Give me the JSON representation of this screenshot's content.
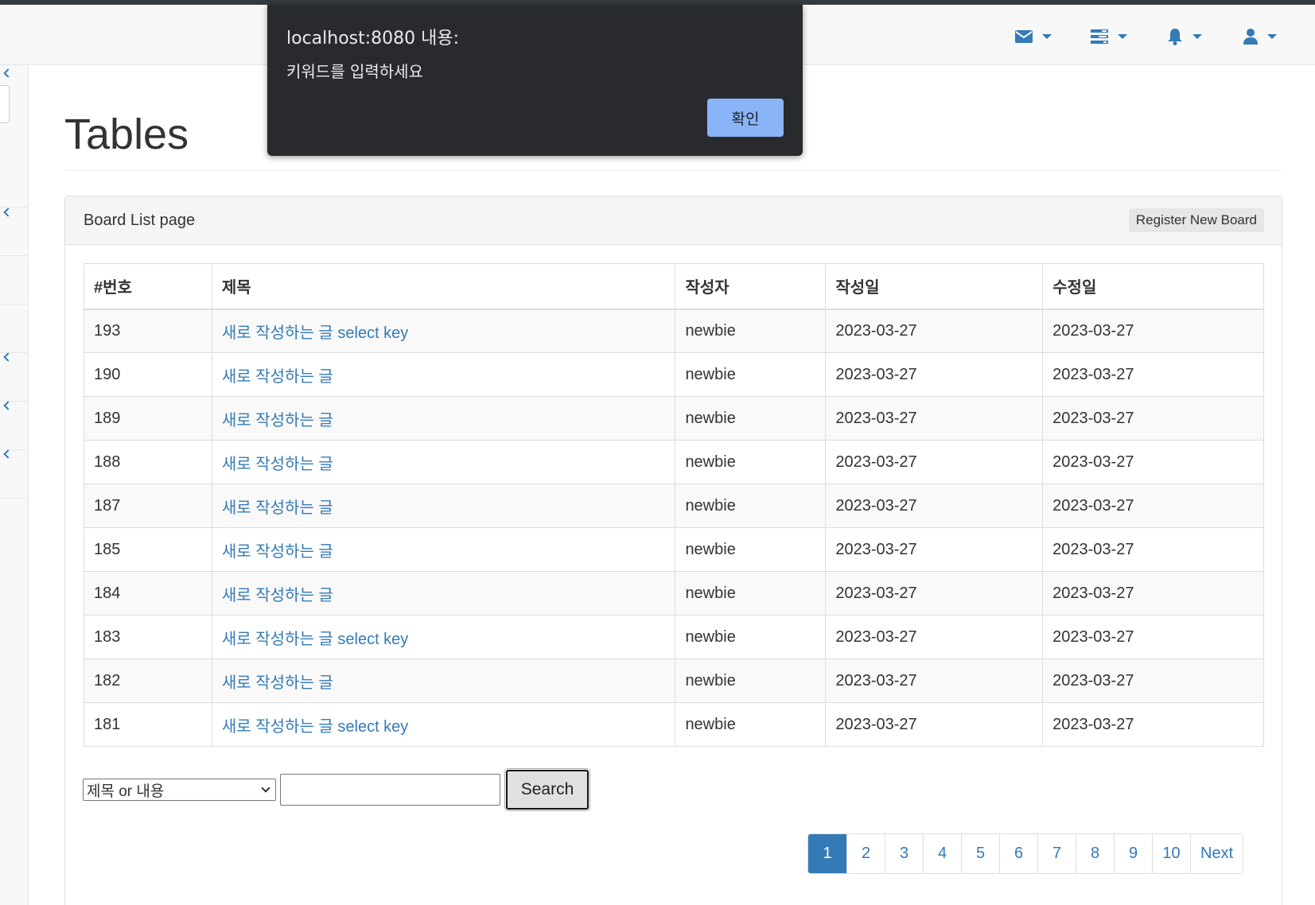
{
  "navbar": {
    "icons": [
      "envelope-icon",
      "tasks-icon",
      "bell-icon",
      "user-icon"
    ]
  },
  "page": {
    "title": "Tables"
  },
  "panel": {
    "heading": "Board List page",
    "register_label": "Register New Board"
  },
  "table": {
    "headers": [
      "#번호",
      "제목",
      "작성자",
      "작성일",
      "수정일"
    ],
    "rows": [
      {
        "bno": "193",
        "title": "새로 작성하는 글 select key",
        "writer": "newbie",
        "regdate": "2023-03-27",
        "updatedate": "2023-03-27"
      },
      {
        "bno": "190",
        "title": "새로 작성하는 글",
        "writer": "newbie",
        "regdate": "2023-03-27",
        "updatedate": "2023-03-27"
      },
      {
        "bno": "189",
        "title": "새로 작성하는 글",
        "writer": "newbie",
        "regdate": "2023-03-27",
        "updatedate": "2023-03-27"
      },
      {
        "bno": "188",
        "title": "새로 작성하는 글",
        "writer": "newbie",
        "regdate": "2023-03-27",
        "updatedate": "2023-03-27"
      },
      {
        "bno": "187",
        "title": "새로 작성하는 글",
        "writer": "newbie",
        "regdate": "2023-03-27",
        "updatedate": "2023-03-27"
      },
      {
        "bno": "185",
        "title": "새로 작성하는 글",
        "writer": "newbie",
        "regdate": "2023-03-27",
        "updatedate": "2023-03-27"
      },
      {
        "bno": "184",
        "title": "새로 작성하는 글",
        "writer": "newbie",
        "regdate": "2023-03-27",
        "updatedate": "2023-03-27"
      },
      {
        "bno": "183",
        "title": "새로 작성하는 글 select key",
        "writer": "newbie",
        "regdate": "2023-03-27",
        "updatedate": "2023-03-27"
      },
      {
        "bno": "182",
        "title": "새로 작성하는 글",
        "writer": "newbie",
        "regdate": "2023-03-27",
        "updatedate": "2023-03-27"
      },
      {
        "bno": "181",
        "title": "새로 작성하는 글 select key",
        "writer": "newbie",
        "regdate": "2023-03-27",
        "updatedate": "2023-03-27"
      }
    ]
  },
  "search": {
    "selected_option": "제목 or 내용",
    "keyword_value": "",
    "button_label": "Search"
  },
  "pagination": {
    "pages": [
      "1",
      "2",
      "3",
      "4",
      "5",
      "6",
      "7",
      "8",
      "9",
      "10"
    ],
    "active_page": "1",
    "next_label": "Next"
  },
  "alert": {
    "title": "localhost:8080 내용:",
    "message": "키워드를 입력하세요",
    "ok_label": "확인"
  },
  "colors": {
    "link": "#337ab7",
    "dialog_bg": "#292a2d",
    "dialog_button": "#8ab4f8"
  }
}
